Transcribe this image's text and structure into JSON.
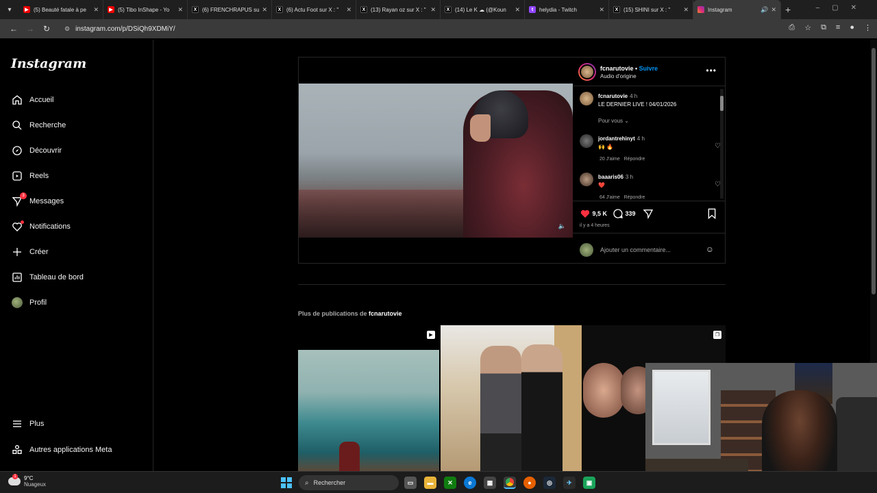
{
  "browser": {
    "tabs": [
      {
        "title": "(5) Beauté fatale à pe",
        "favicon": "youtube-icon"
      },
      {
        "title": "(5) Tibo InShape - Yo",
        "favicon": "youtube-icon"
      },
      {
        "title": "(6) FRENCHRAPUS su",
        "favicon": "x-icon"
      },
      {
        "title": "(6) Actu Foot sur X : \"",
        "favicon": "x-icon"
      },
      {
        "title": "(13) Rayan oz sur X : \"",
        "favicon": "x-icon"
      },
      {
        "title": "(14) Le K ☁ (@Koun",
        "favicon": "x-icon"
      },
      {
        "title": "helydia - Twitch",
        "favicon": "twitch-icon"
      },
      {
        "title": "(15) SHINI sur X : \"",
        "favicon": "x-icon"
      },
      {
        "title": "Instagram",
        "favicon": "instagram-icon"
      }
    ],
    "url": "instagram.com/p/DSiQh9XDMiY/"
  },
  "sidebar": {
    "logo": "Instagram",
    "items": [
      {
        "label": "Accueil",
        "icon": "home-icon"
      },
      {
        "label": "Recherche",
        "icon": "search-icon"
      },
      {
        "label": "Découvrir",
        "icon": "compass-icon"
      },
      {
        "label": "Reels",
        "icon": "reels-icon"
      },
      {
        "label": "Messages",
        "icon": "messenger-icon",
        "badge": "3"
      },
      {
        "label": "Notifications",
        "icon": "heart-icon"
      },
      {
        "label": "Créer",
        "icon": "plus-icon"
      },
      {
        "label": "Tableau de bord",
        "icon": "dashboard-icon"
      },
      {
        "label": "Profil",
        "icon": "avatar"
      }
    ],
    "bottom": [
      {
        "label": "Plus",
        "icon": "menu-icon"
      },
      {
        "label": "Autres applications Meta",
        "icon": "meta-apps-icon"
      }
    ]
  },
  "post": {
    "author": "fcnarutovie",
    "follow": "Suivre",
    "subtitle": "Audio d'origine",
    "caption_user": "fcnarutovie",
    "caption_time": "4 h",
    "caption_text": "LE DERNIER LIVE ! 04/01/2026",
    "sort_label": "Pour vous",
    "comments": [
      {
        "user": "jordantrehinyt",
        "time": "4 h",
        "text": "🙌 🔥",
        "likes": "20 J'aime",
        "reply": "Répondre"
      },
      {
        "user": "baaaris06",
        "time": "3 h",
        "text": "❤️",
        "likes": "64 J'aime",
        "reply": "Répondre"
      }
    ],
    "like_count": "9,5 K",
    "comment_count": "339",
    "time_ago": "il y a 4 heures",
    "add_comment_placeholder": "Ajouter un commentaire..."
  },
  "more": {
    "prefix": "Plus de publications de",
    "user": "fcnarutovie"
  },
  "taskbar": {
    "temperature": "9°C",
    "weather": "Nuageux",
    "weather_badge": "1",
    "search_label": "Rechercher"
  },
  "colors": {
    "accent": "#0095f6",
    "like": "#ff3040",
    "background": "#000000",
    "border": "#262626"
  }
}
